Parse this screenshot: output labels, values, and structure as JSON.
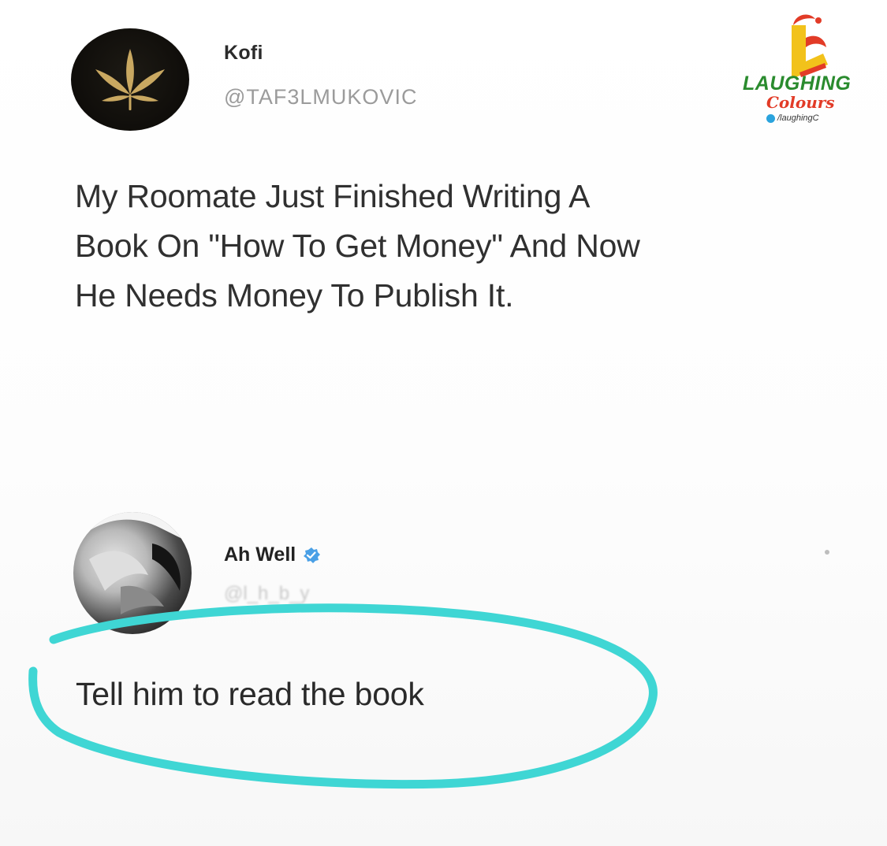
{
  "tweet": {
    "author_name": "Kofi",
    "author_handle": "@TAF3LMUKOVIC",
    "avatar_icon": "cannabis-leaf-icon",
    "text": "My Roomate Just Finished Writing A\nBook On \"How To Get Money\" And Now\nHe Needs Money To Publish It."
  },
  "reply": {
    "author_name": "Ah Well",
    "badge_icon": "verified-badge-icon",
    "text": "Tell him to read the book",
    "annotation_color": "#3fd6d4"
  },
  "watermark": {
    "title": "LAUGHING",
    "subtitle": "Colours",
    "handle": "/laughingC",
    "colors": {
      "green": "#2a8b2e",
      "red": "#e23b27",
      "yellow": "#f2c21b"
    }
  }
}
